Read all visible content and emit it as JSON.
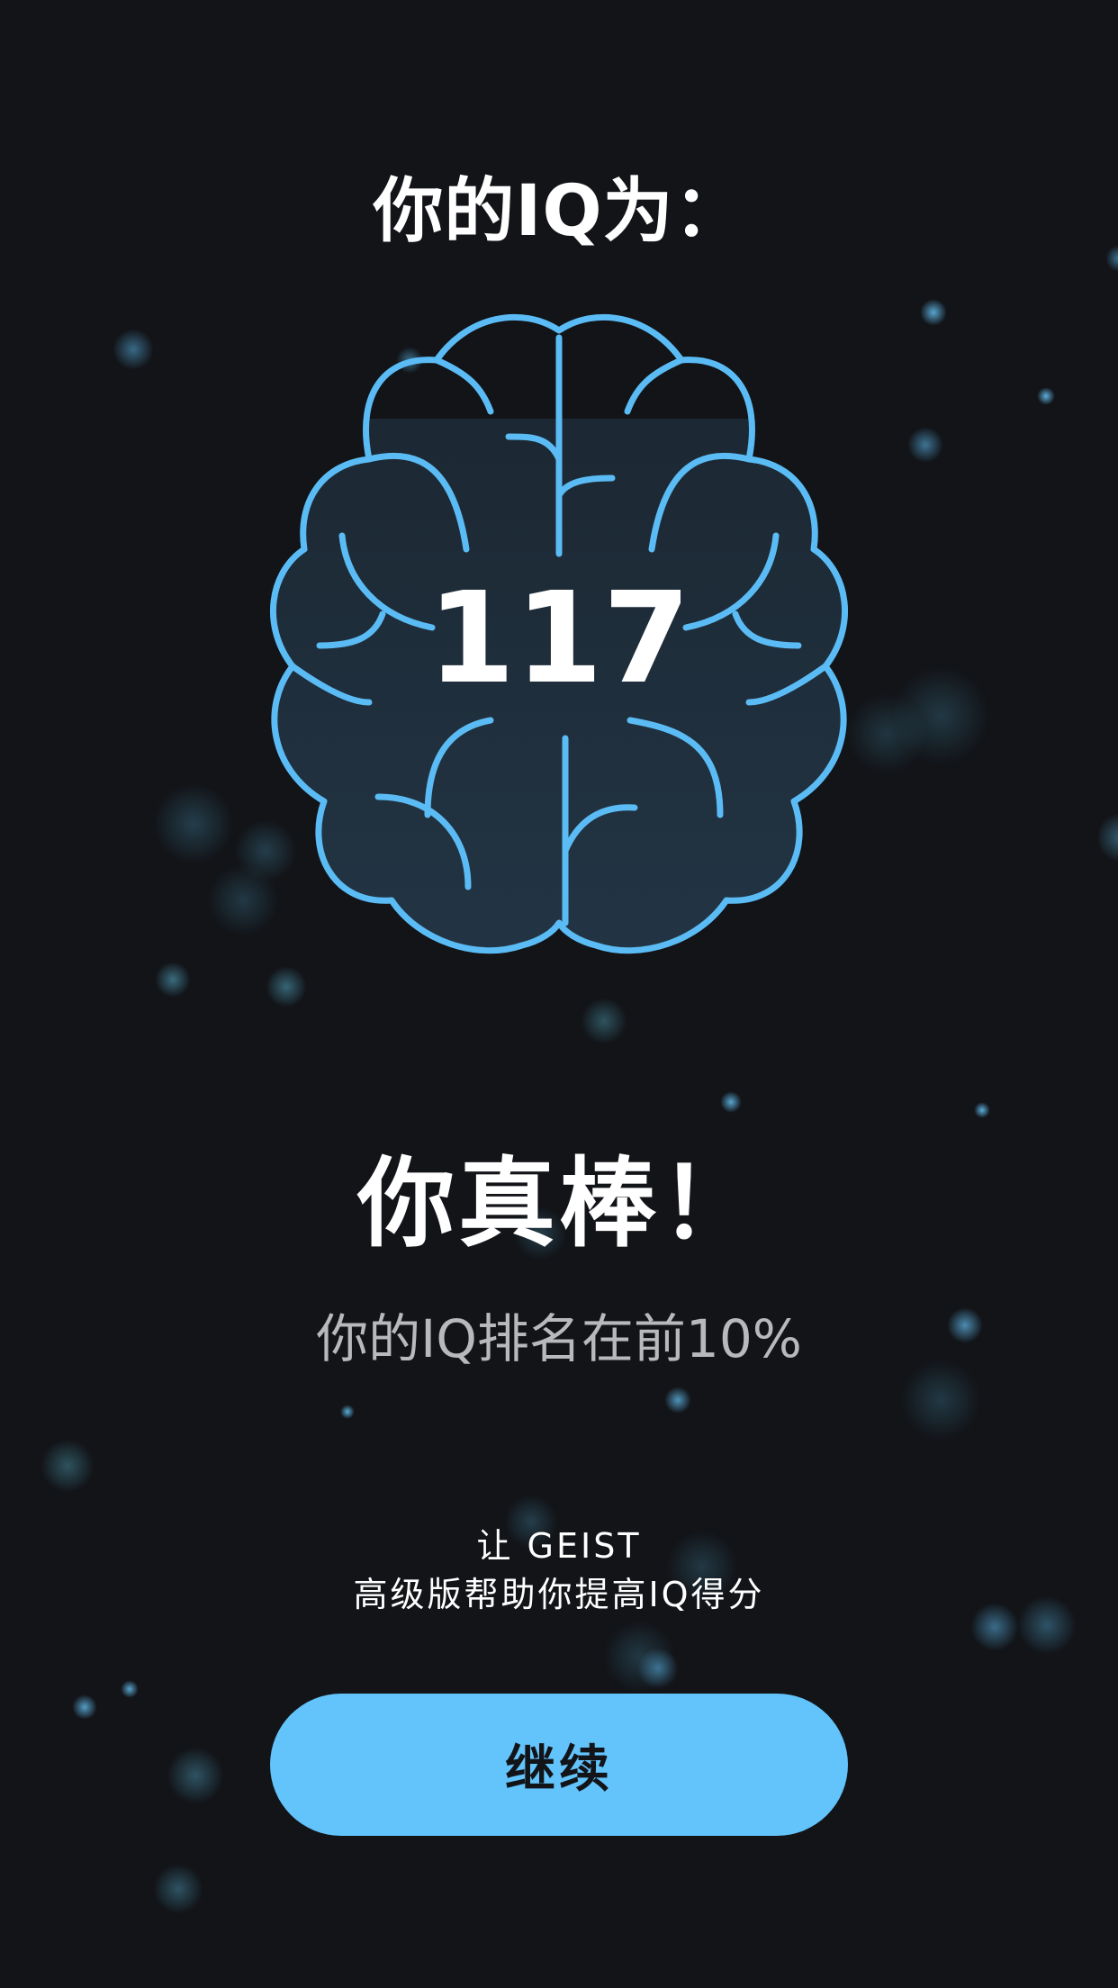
{
  "result": {
    "title": "你的IQ为：",
    "iq_score": "117",
    "headline": "你真棒！",
    "ranking_text": "你的IQ排名在前10%"
  },
  "promo": {
    "line1": "让 GEIST",
    "line2": "高级版帮助你提高IQ得分"
  },
  "actions": {
    "continue_label": "继续"
  },
  "theme": {
    "background": "#121418",
    "accent": "#63c3fb",
    "brain_outline": "#5bbcf5"
  },
  "icons": {
    "brain": "brain-icon"
  }
}
